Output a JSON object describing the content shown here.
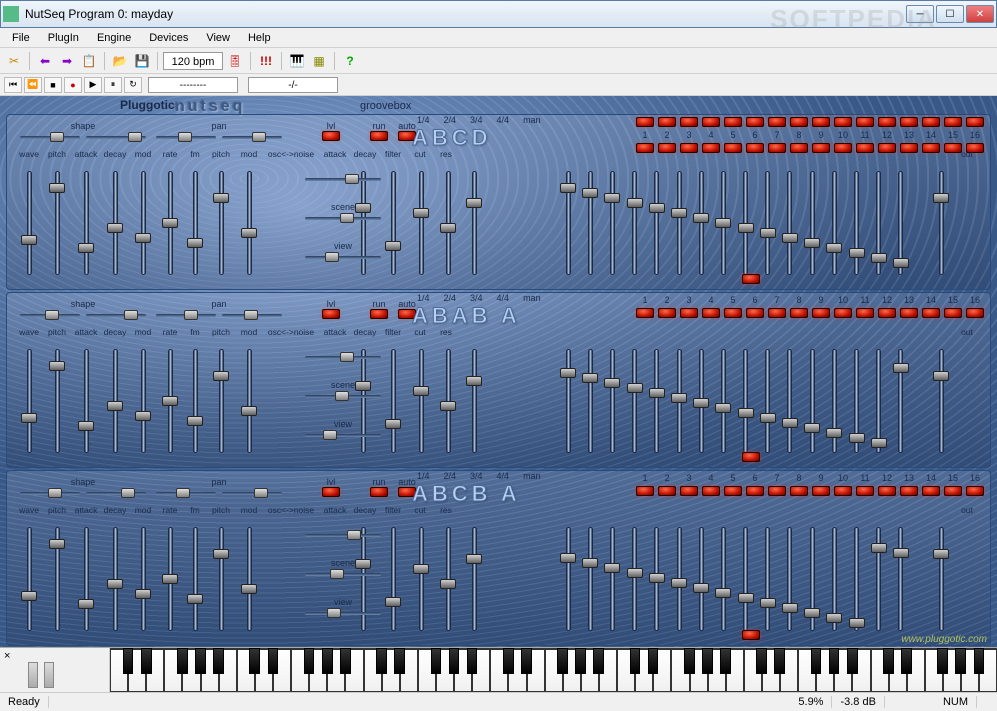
{
  "window": {
    "title": "NutSeq Program 0: mayday"
  },
  "menus": [
    "File",
    "PlugIn",
    "Engine",
    "Devices",
    "View",
    "Help"
  ],
  "toolbar": {
    "tempo": "120 bpm",
    "icons": [
      "scissors",
      "back",
      "forward",
      "copy",
      "open",
      "save",
      "metronome",
      "alert",
      "keyboard",
      "midi",
      "help"
    ]
  },
  "transport": {
    "pos1": "--------",
    "pos2": "-/-"
  },
  "plugin": {
    "brand_pre": "Pluggotic",
    "brand_main": "nutseq",
    "brand_post": "groovebox",
    "url": "www.pluggotic.com",
    "top_labels": {
      "shape": "shape",
      "pan": "pan",
      "lvl": "lvl",
      "run": "run",
      "auto": "auto"
    },
    "timing": [
      "1/4",
      "2/4",
      "3/4",
      "4/4",
      "man"
    ],
    "param_labels": [
      "wave",
      "pitch",
      "attack",
      "decay",
      "mod",
      "rate",
      "fm",
      "pitch",
      "mod",
      "osc<->noise",
      "attack",
      "decay",
      "filter",
      "cut",
      "res"
    ],
    "out_label": "out",
    "mid_labels": {
      "scene": "scene",
      "view": "view"
    },
    "step_nums": [
      "1",
      "2",
      "3",
      "4",
      "5",
      "6",
      "7",
      "8",
      "9",
      "10",
      "11",
      "12",
      "13",
      "14",
      "15",
      "16"
    ],
    "sections": [
      {
        "pattern": "ABCD",
        "slider_pos": {
          "top_shape": [
            30,
            42
          ],
          "top_pan": [
            22,
            30
          ],
          "top_lvl": 45,
          "osc": 40,
          "scene": 35,
          "view": 20
        }
      },
      {
        "pattern": "ABAB A",
        "slider_pos": {
          "top_shape": [
            25,
            38
          ],
          "top_pan": [
            28,
            22
          ],
          "top_lvl": 40,
          "osc": 35,
          "scene": 30,
          "view": 18
        }
      },
      {
        "pattern": "ABCB A",
        "slider_pos": {
          "top_shape": [
            28,
            35
          ],
          "top_pan": [
            20,
            32
          ],
          "top_lvl": 38,
          "osc": 42,
          "scene": 25,
          "view": 22
        }
      }
    ]
  },
  "status": {
    "ready": "Ready",
    "cpu": "5.9%",
    "db": "-3.8 dB",
    "num": "NUM"
  },
  "watermark": "SOFTPEDIA"
}
